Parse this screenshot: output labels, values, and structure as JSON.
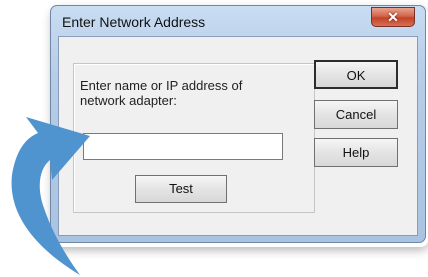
{
  "window": {
    "title": "Enter Network Address",
    "close_glyph": "✕"
  },
  "form": {
    "prompt": "Enter name or IP address of network adapter:",
    "address_value": "",
    "address_placeholder": ""
  },
  "buttons": {
    "ok": "OK",
    "cancel": "Cancel",
    "help": "Help",
    "test": "Test"
  },
  "icons": {
    "close": "close-icon",
    "annotation_arrow": "curved-arrow-icon"
  },
  "colors": {
    "arrow": "#4f94cf",
    "frame": "#b6cde8",
    "close_button": "#c94c31"
  }
}
